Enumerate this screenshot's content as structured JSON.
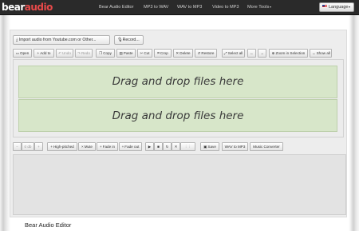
{
  "logo": {
    "part1": "bear",
    "part2": "audio"
  },
  "nav": {
    "items": [
      "Bear Audio Editor",
      "MP3 to WAV",
      "WAV to MP3",
      "Video to MP3",
      "More Tools"
    ],
    "language": "Language"
  },
  "import": {
    "youtube_label": "Import audio from Youtube.com or Other...",
    "record_label": "Record..."
  },
  "toolbar": {
    "open": "Open",
    "add_to": "Add to",
    "undo": "Undo",
    "redo": "Redo",
    "copy": "Copy",
    "paste": "Paste",
    "cut": "Cut",
    "crop": "Crop",
    "delete": "Delete",
    "restore": "Restore",
    "select_all": "Select all",
    "zoom_selection": "Zoom in Selection",
    "show_all": "Show all"
  },
  "dropzone": {
    "label1": "Drag and drop files here",
    "label2": "Drag and drop files here"
  },
  "controls": {
    "volume_value": "0 db",
    "high_pitched": "High-pitched",
    "mute": "Mute",
    "fade_in": "Fade in",
    "fade_out": "Fade out",
    "save": "Save",
    "wav_to_mp3": "WAV to MP3",
    "music_converter": "Music Converter"
  },
  "footer": {
    "title": "Bear Audio Editor"
  },
  "colors": {
    "accent": "#e84a4a",
    "drop_bg": "#d7e6c9",
    "navbar": "#2a2a2a"
  }
}
